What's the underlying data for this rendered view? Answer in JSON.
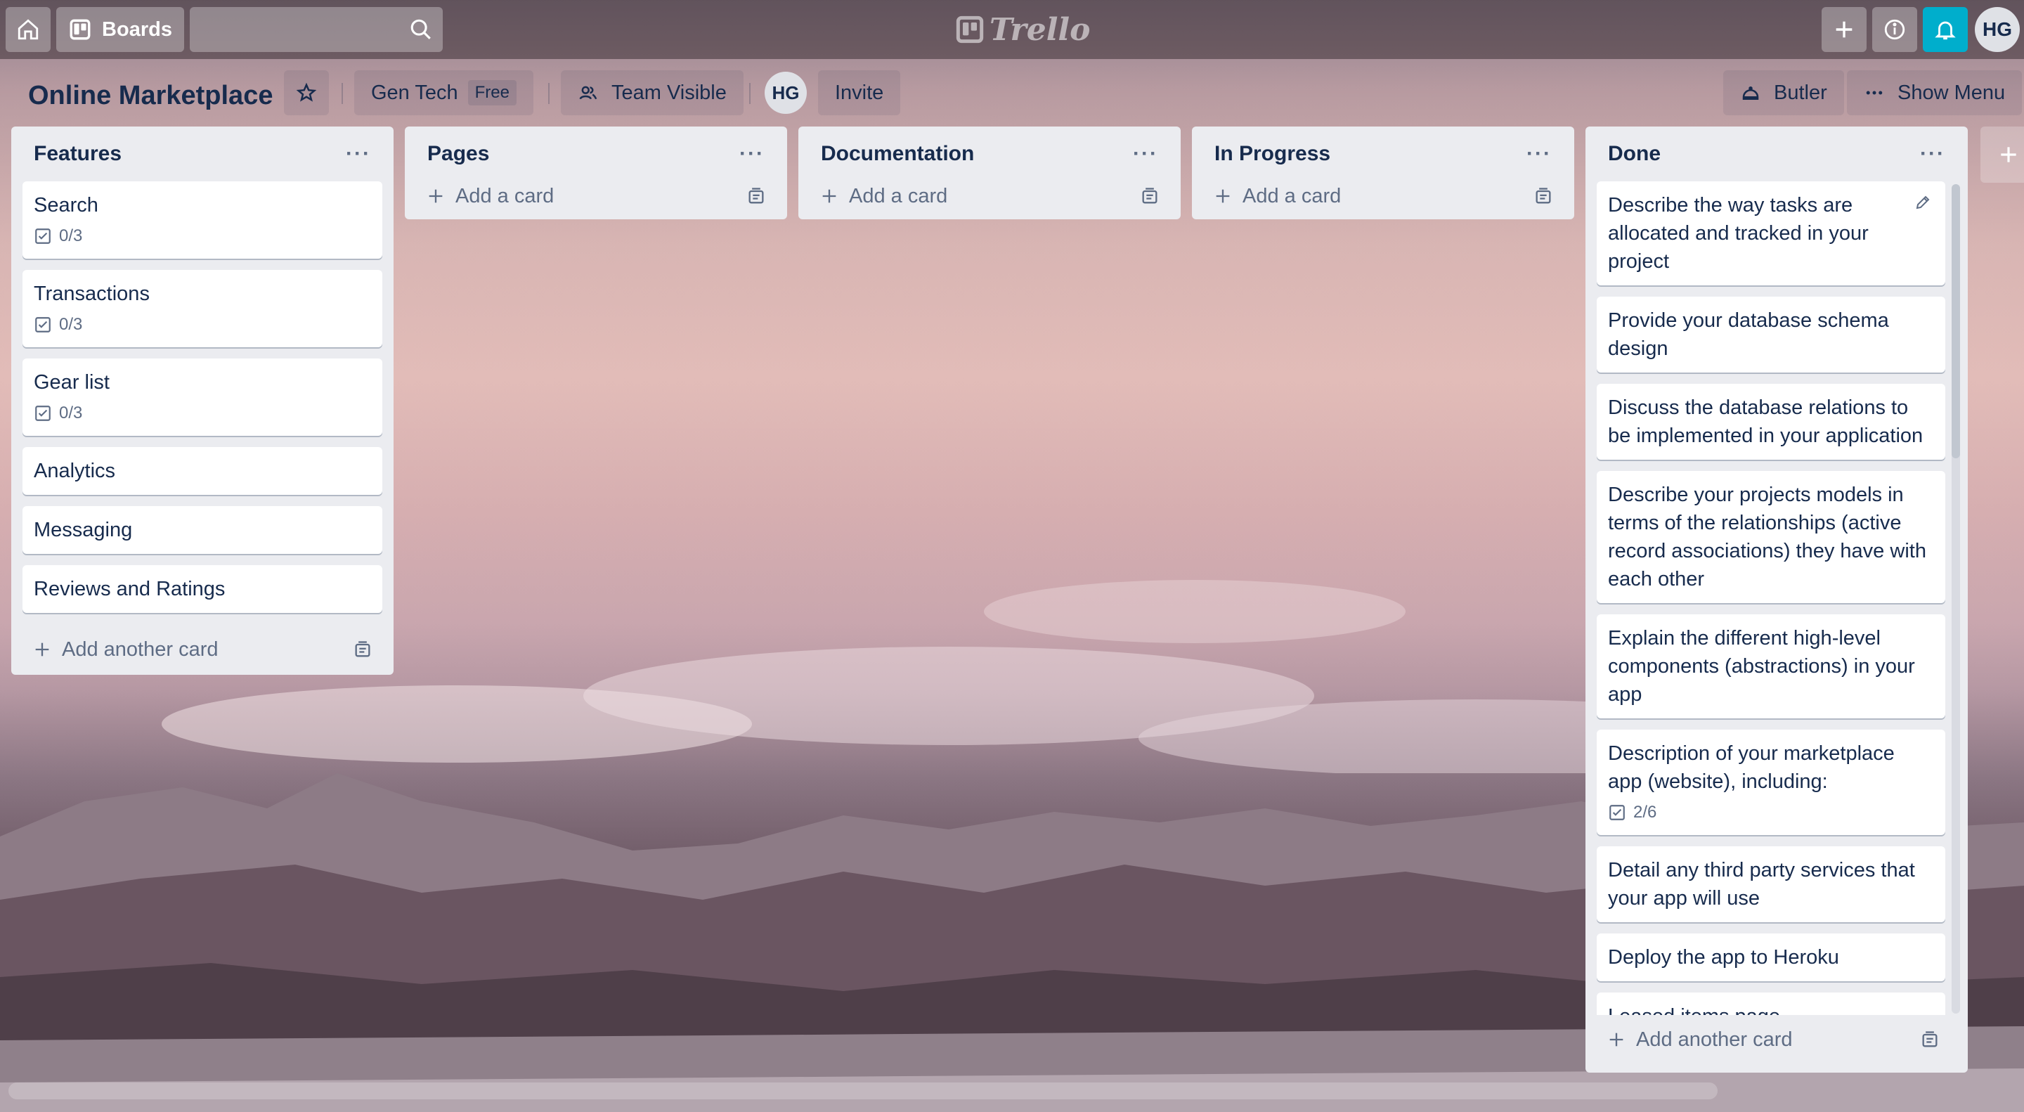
{
  "topbar": {
    "boards_label": "Boards",
    "logo_text": "Trello",
    "user_initials": "HG"
  },
  "board": {
    "title": "Online Marketplace",
    "team_name": "Gen Tech",
    "plan_badge": "Free",
    "visibility_label": "Team Visible",
    "member_initials": "HG",
    "invite_label": "Invite",
    "butler_label": "Butler",
    "show_menu_label": "Show Menu"
  },
  "lists": [
    {
      "title": "Features",
      "cards": [
        {
          "title": "Search",
          "checklist": "0/3"
        },
        {
          "title": "Transactions",
          "checklist": "0/3"
        },
        {
          "title": "Gear list",
          "checklist": "0/3"
        },
        {
          "title": "Analytics"
        },
        {
          "title": "Messaging"
        },
        {
          "title": "Reviews and Ratings"
        }
      ],
      "add_label": "Add another card"
    },
    {
      "title": "Pages",
      "cards": [],
      "add_label": "Add a card"
    },
    {
      "title": "Documentation",
      "cards": [],
      "add_label": "Add a card"
    },
    {
      "title": "In Progress",
      "cards": [],
      "add_label": "Add a card"
    },
    {
      "title": "Done",
      "cards": [
        {
          "title": "Describe the way tasks are allocated and tracked in your project"
        },
        {
          "title": "Provide your database schema design"
        },
        {
          "title": "Discuss the database relations to be implemented in your application"
        },
        {
          "title": "Describe your projects models in terms of the relationships (active record associations) they have with each other"
        },
        {
          "title": "Explain the different high-level components (abstractions) in your app"
        },
        {
          "title": "Description of your marketplace app (website), including:",
          "checklist": "2/6"
        },
        {
          "title": "Detail any third party services that your app will use"
        },
        {
          "title": "Deploy the app to Heroku"
        },
        {
          "title": "Leased items page"
        }
      ],
      "add_label": "Add another card"
    }
  ],
  "icons": {
    "home": "home-icon",
    "boards": "boards-icon",
    "search": "search-icon",
    "plus": "plus-icon",
    "info": "info-icon",
    "bell": "bell-icon",
    "star": "star-icon",
    "team": "team-icon",
    "butler": "butler-icon",
    "more": "more-icon",
    "checklist": "checklist-icon",
    "template": "card-template-icon",
    "edit": "pencil-icon"
  },
  "colors": {
    "notification_accent": "#00aecc",
    "list_bg": "#ebecf0",
    "text_primary": "#172b4d",
    "text_muted": "#5e6c84"
  }
}
